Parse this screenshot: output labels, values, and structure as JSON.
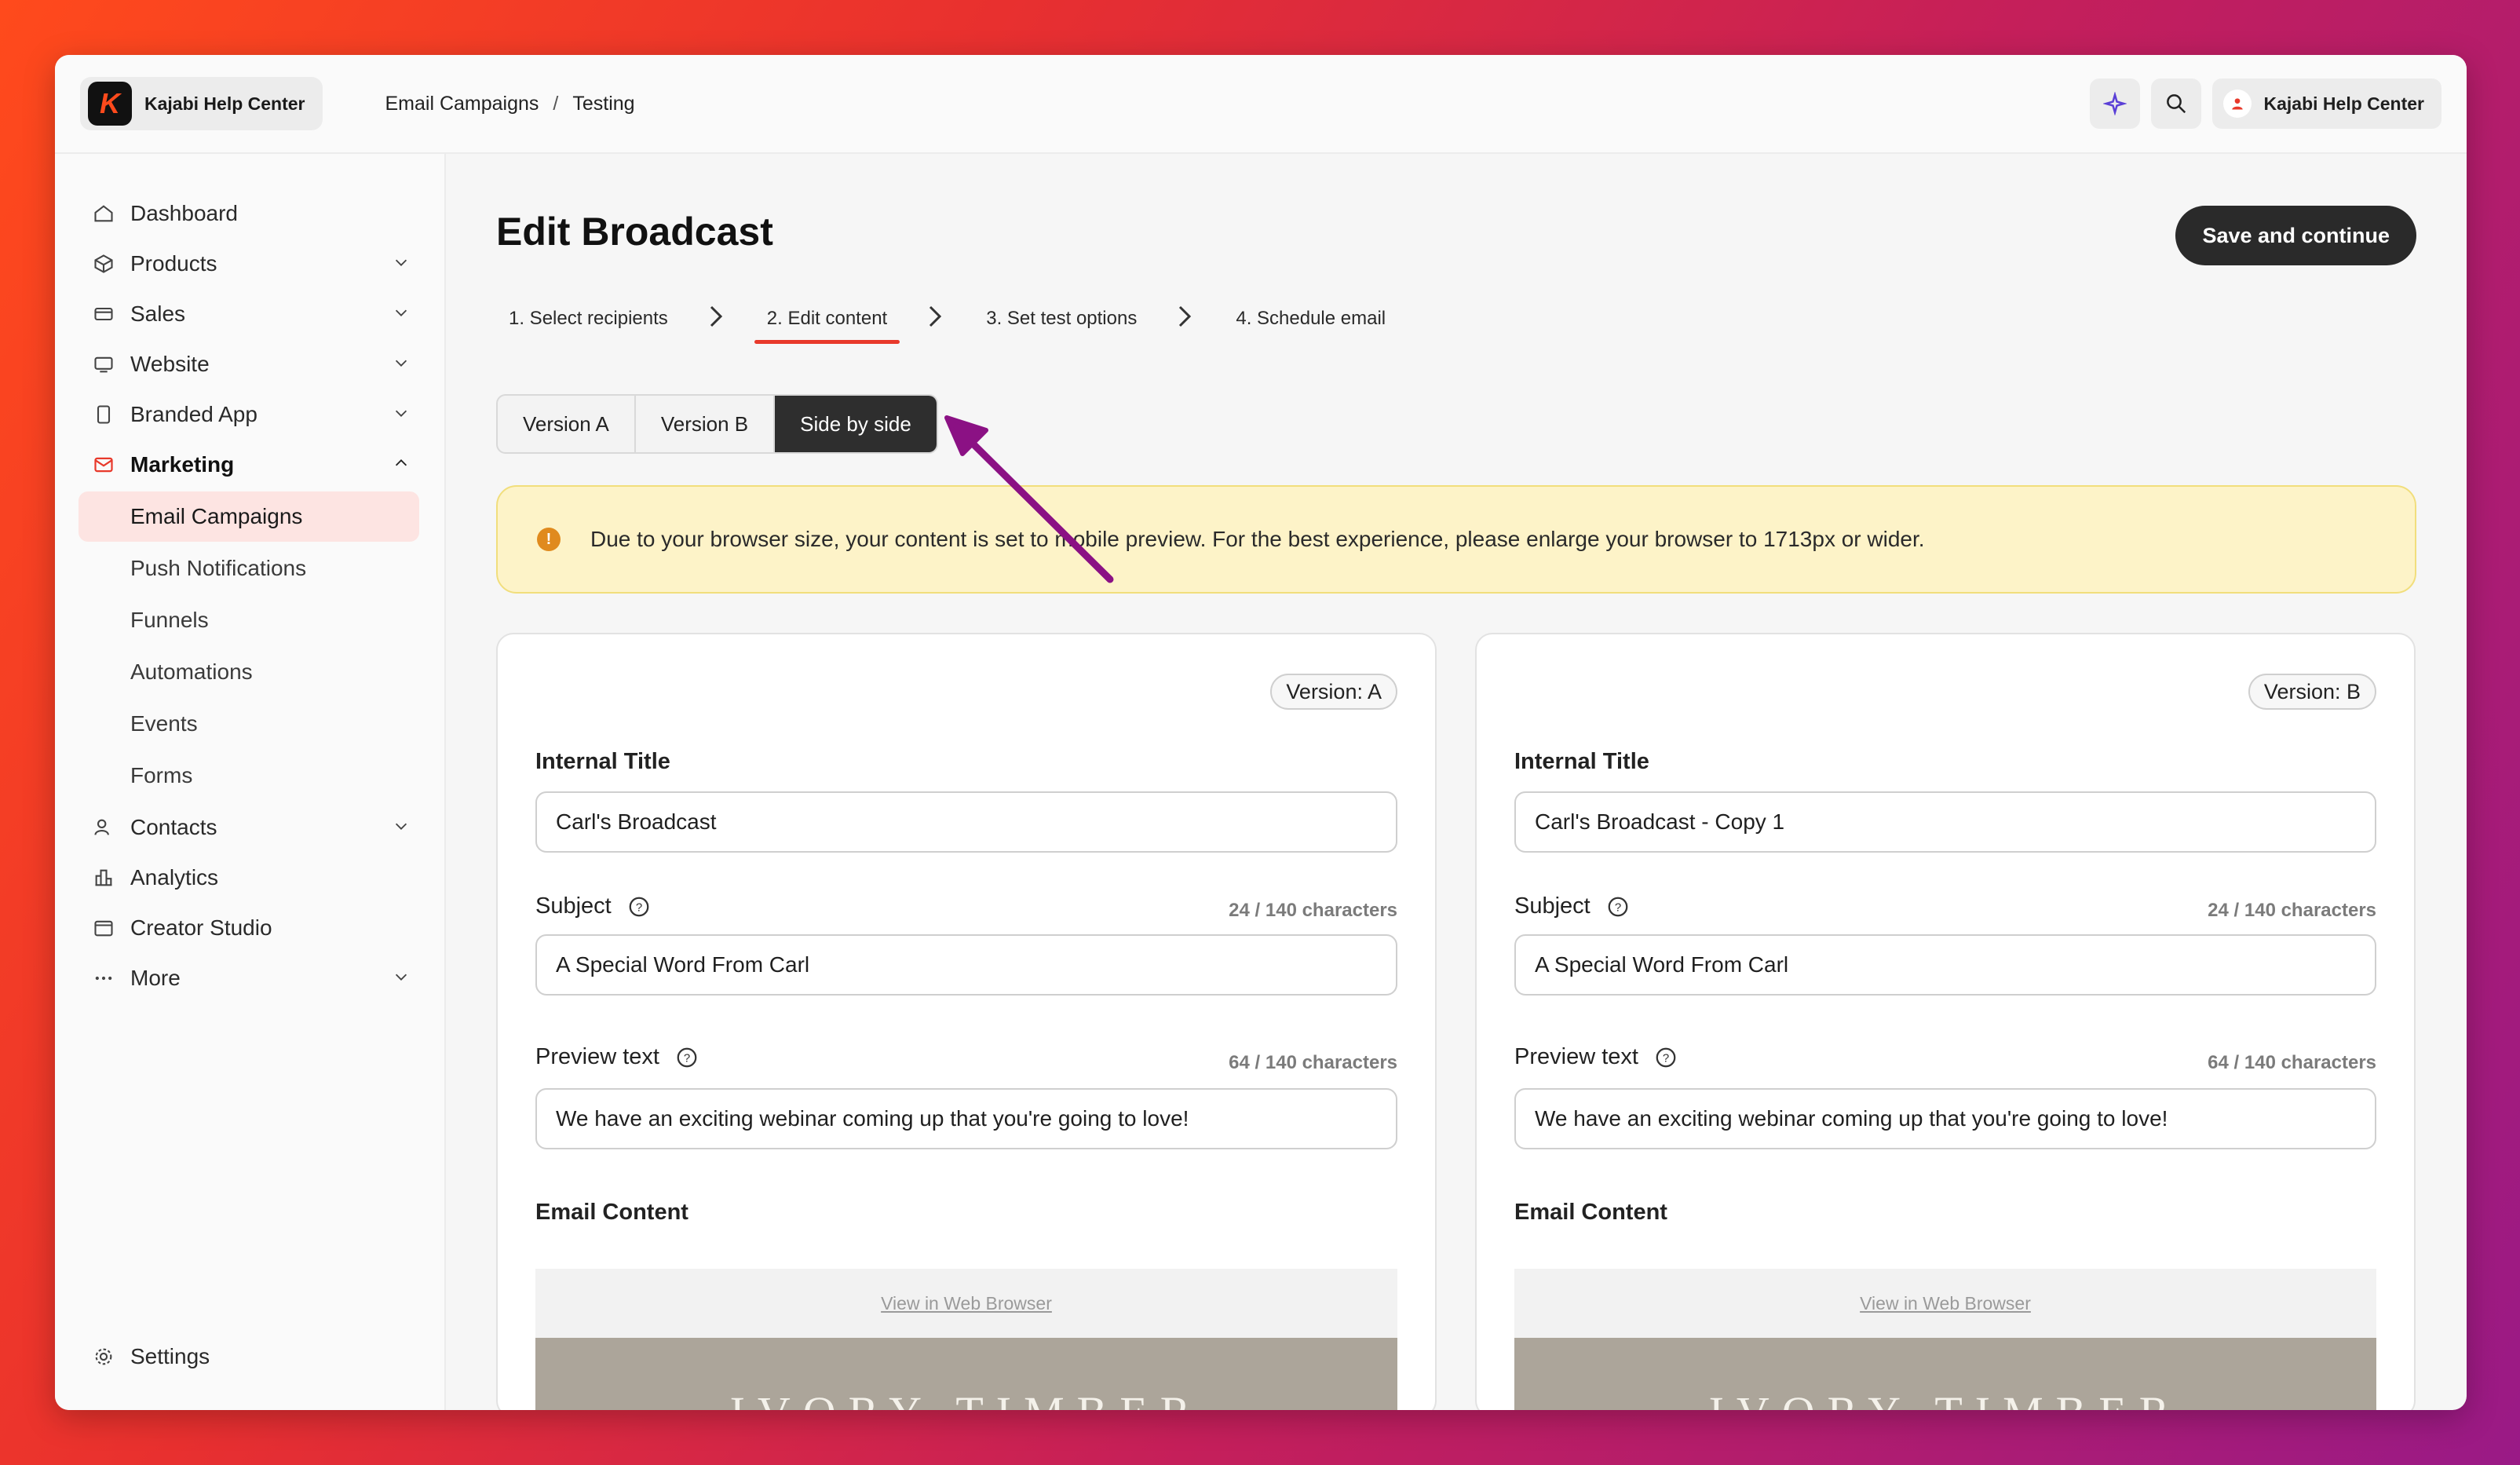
{
  "brand": {
    "name": "Kajabi Help Center",
    "logo_letter": "K"
  },
  "breadcrumb": {
    "parent": "Email Campaigns",
    "separator": "/",
    "current": "Testing"
  },
  "topbar": {
    "user_label": "Kajabi Help Center"
  },
  "sidebar": {
    "items": [
      {
        "label": "Dashboard"
      },
      {
        "label": "Products"
      },
      {
        "label": "Sales"
      },
      {
        "label": "Website"
      },
      {
        "label": "Branded App"
      },
      {
        "label": "Marketing"
      },
      {
        "label": "Contacts"
      },
      {
        "label": "Analytics"
      },
      {
        "label": "Creator Studio"
      },
      {
        "label": "More"
      }
    ],
    "marketing_sub": [
      {
        "label": "Email Campaigns"
      },
      {
        "label": "Push Notifications"
      },
      {
        "label": "Funnels"
      },
      {
        "label": "Automations"
      },
      {
        "label": "Events"
      },
      {
        "label": "Forms"
      }
    ],
    "settings_label": "Settings"
  },
  "page": {
    "title": "Edit Broadcast",
    "save_label": "Save and continue",
    "steps": [
      {
        "label": "1. Select recipients"
      },
      {
        "label": "2. Edit content"
      },
      {
        "label": "3. Set test options"
      },
      {
        "label": "4. Schedule email"
      }
    ],
    "view_toggle": [
      "Version A",
      "Version B",
      "Side by side"
    ],
    "alert": "Due to your browser size, your content is set to mobile preview. For the best experience, please enlarge your browser to 1713px or wider."
  },
  "panels": [
    {
      "badge": "Version: A",
      "internal_title_label": "Internal Title",
      "internal_title_value": "Carl's Broadcast",
      "subject_label": "Subject",
      "subject_counter": "24 / 140 characters",
      "subject_value": "A Special Word From Carl",
      "preview_label": "Preview text",
      "preview_counter": "64 / 140 characters",
      "preview_value": "We have an exciting webinar coming up that you're going to love!",
      "email_content_label": "Email Content",
      "web_link": "View in Web Browser",
      "hero_text": "IVORY TIMBER"
    },
    {
      "badge": "Version: B",
      "internal_title_label": "Internal Title",
      "internal_title_value": "Carl's Broadcast - Copy 1",
      "subject_label": "Subject",
      "subject_counter": "24 / 140 characters",
      "subject_value": "A Special Word From Carl",
      "preview_label": "Preview text",
      "preview_counter": "64 / 140 characters",
      "preview_value": "We have an exciting webinar coming up that you're going to love!",
      "email_content_label": "Email Content",
      "web_link": "View in Web Browser",
      "hero_text": "IVORY TIMBER"
    }
  ],
  "colors": {
    "accent": "#e8392b",
    "annotation_arrow": "#8b1184"
  }
}
